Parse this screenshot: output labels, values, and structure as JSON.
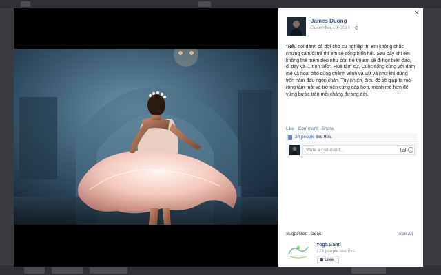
{
  "post": {
    "author": "James Duong",
    "date": "December 19, 2014",
    "separator": "·",
    "text": "\"Nếu nói dành cả đời cho sự nghiệp thì em không chắc nhưng cả tuổi trẻ thì em sẽ cống hiến hết. Sau đấy khi em không thể mềm dẻo như còn trẻ thì em sẽ đi học biên đạo, đi dạy và ... tính tiếp\". Huê tâm sự. Cuộc sống cùng với đam mê và hoài bão cũng chênh vênh và vất vả như khi đứng trên năm đầu ngón chân. Tuy nhiên, điều đó sẽ giúp ta mở rộng tầm mắt và trở nên cứng cáp hơn, mạnh mẽ hơn để vững bước trên mỗi chặng đường đời."
  },
  "actions": {
    "like": "Like",
    "comment": "Comment",
    "share": "Share",
    "dot": "·"
  },
  "likes": {
    "count_link": "34 people",
    "suffix": " like this."
  },
  "comment": {
    "placeholder": "Write a comment..."
  },
  "suggested": {
    "title": "Suggested Pages",
    "see_all": "See All",
    "page_name": "Yoga Santi",
    "page_likes": "223 people like this.",
    "like_button": "Like"
  },
  "colors": {
    "link": "#3b5998",
    "text": "#1d2129",
    "muted": "#90949c"
  },
  "icons": [
    "close-icon",
    "globe-icon",
    "like-thumb-icon",
    "camera-icon",
    "emoji-icon"
  ]
}
